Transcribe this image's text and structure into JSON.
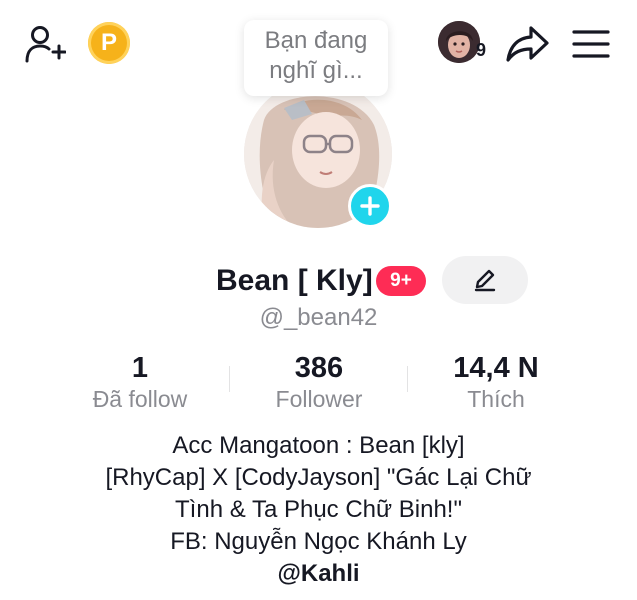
{
  "header": {
    "add_friend_icon": "person-plus-icon",
    "coin_label": "P",
    "coin_color": "#f6b21a",
    "story_count": "9",
    "share_icon": "share-arrow-icon",
    "menu_icon": "hamburger-menu-icon"
  },
  "bubble": {
    "line1": "Bạn đang",
    "line2": "nghĩ gì..."
  },
  "profile": {
    "display_name": "Bean [ Kly]",
    "badge": "9+",
    "badge_color": "#fe2c55",
    "username": "@_bean42",
    "add_icon_color": "#20d5ec"
  },
  "stats": [
    {
      "value": "1",
      "label": "Đã follow"
    },
    {
      "value": "386",
      "label": "Follower"
    },
    {
      "value": "14,4 N",
      "label": "Thích"
    }
  ],
  "bio": {
    "lines": [
      "Acc Mangatoon : Bean [kly]",
      "[RhyCap] X [CodyJayson] \"Gác Lại Chữ",
      "Tình & Ta Phục Chữ Binh!\"",
      "FB: Nguyễn Ngọc Khánh Ly"
    ],
    "mention": "@Kahli"
  }
}
